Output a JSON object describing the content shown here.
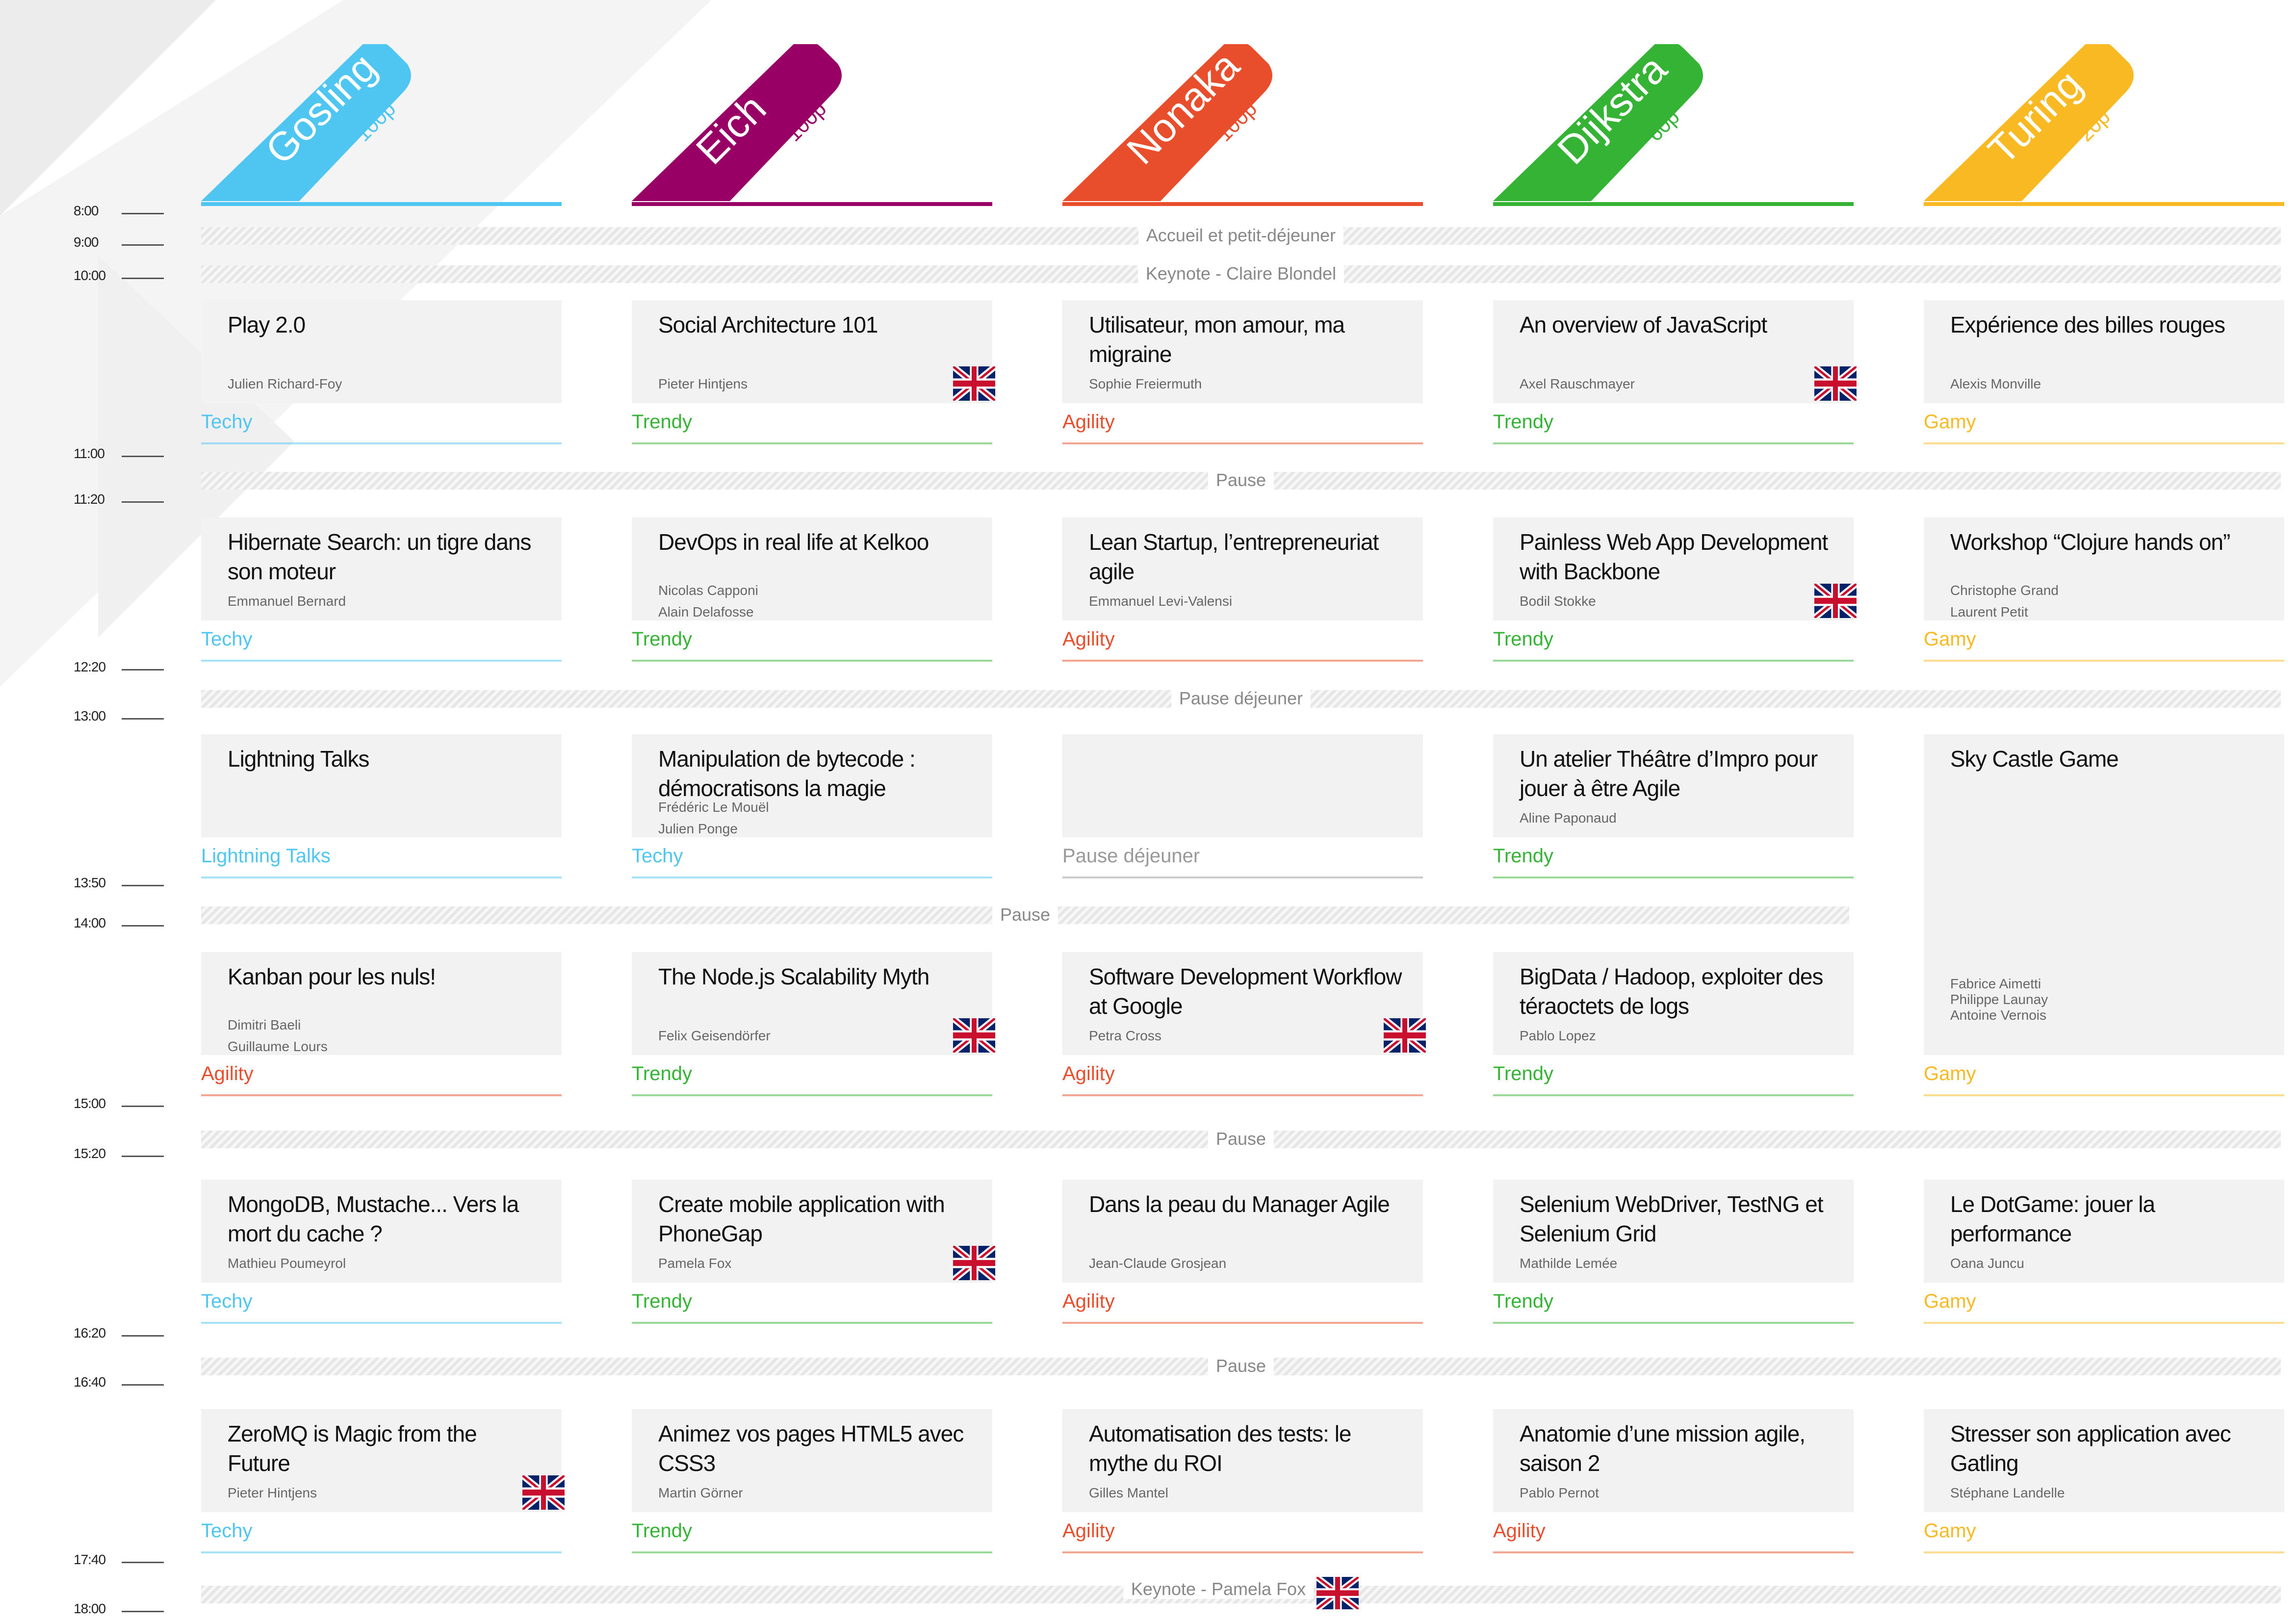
{
  "rooms": [
    {
      "name": "Gosling",
      "capacity": "100p",
      "color": "#4fc6f2"
    },
    {
      "name": "Eich",
      "capacity": "100p",
      "color": "#990066"
    },
    {
      "name": "Nonaka",
      "capacity": "100p",
      "color": "#e94e2c"
    },
    {
      "name": "Dijkstra",
      "capacity": "60p",
      "color": "#35b335"
    },
    {
      "name": "Turing",
      "capacity": "20p",
      "color": "#f8b923"
    }
  ],
  "tracks": {
    "Techy": "#4fc6f2",
    "Trendy": "#35b335",
    "Agility": "#e94e2c",
    "Gamy": "#f8b923",
    "Lightning Talks": "#4fc6f2",
    "Pause déjeuner": "#999999"
  },
  "times": [
    "8:00",
    "9:00",
    "10:00",
    "11:00",
    "11:20",
    "12:20",
    "13:00",
    "13:50",
    "14:00",
    "15:00",
    "15:20",
    "16:20",
    "16:40",
    "17:40",
    "18:00"
  ],
  "breaks": [
    "Accueil et petit-déjeuner",
    "Keynote - Claire Blondel",
    "Pause",
    "Pause déjeuner",
    "Pause",
    "Pause",
    "Pause",
    "Keynote - Pamela Fox"
  ],
  "sessions": [
    [
      {
        "title": "Play 2.0",
        "speakers": [
          "Julien Richard-Foy"
        ],
        "track": "Techy",
        "flag": false
      },
      {
        "title": "Social Architecture 101",
        "speakers": [
          "Pieter Hintjens"
        ],
        "track": "Trendy",
        "flag": true
      },
      {
        "title": "Utilisateur, mon amour, ma migraine",
        "speakers": [
          "Sophie Freiermuth"
        ],
        "track": "Agility",
        "flag": false
      },
      {
        "title": "An overview of JavaScript",
        "speakers": [
          "Axel Rauschmayer"
        ],
        "track": "Trendy",
        "flag": true
      },
      {
        "title": "Expérience des billes rouges",
        "speakers": [
          "Alexis Monville"
        ],
        "track": "Gamy",
        "flag": false
      }
    ],
    [
      {
        "title": "Hibernate Search: un tigre dans son moteur",
        "speakers": [
          "Emmanuel Bernard"
        ],
        "track": "Techy",
        "flag": false
      },
      {
        "title": "DevOps in real life at Kelkoo",
        "speakers": [
          "Nicolas Capponi",
          "Alain Delafosse"
        ],
        "track": "Trendy",
        "flag": false
      },
      {
        "title": "Lean Startup, l’entrepreneuriat agile",
        "speakers": [
          "Emmanuel Levi-Valensi"
        ],
        "track": "Agility",
        "flag": false
      },
      {
        "title": "Painless Web App Development with Backbone",
        "speakers": [
          "Bodil Stokke"
        ],
        "track": "Trendy",
        "flag": true
      },
      {
        "title": "Workshop “Clojure hands on”",
        "speakers": [
          "Christophe Grand",
          "Laurent Petit"
        ],
        "track": "Gamy",
        "flag": false
      }
    ],
    [
      {
        "title": "Lightning Talks",
        "speakers": [],
        "track": "Lightning Talks",
        "flag": false
      },
      {
        "title": "Manipulation de bytecode : démocratisons la magie",
        "speakers": [
          "Frédéric Le Mouël",
          "Julien Ponge"
        ],
        "track": "Techy",
        "flag": false
      },
      {
        "title": "",
        "speakers": [],
        "track": "Pause déjeuner",
        "flag": false
      },
      {
        "title": "Un atelier Théâtre d’Impro pour jouer à être Agile",
        "speakers": [
          "Aline Paponaud"
        ],
        "track": "Trendy",
        "flag": false
      },
      {
        "title": "Sky Castle Game",
        "speakers": [
          "Fabrice Aimetti",
          "Philippe Launay",
          "Antoine Vernois"
        ],
        "track": "Gamy",
        "flag": false
      }
    ],
    [
      {
        "title": "Kanban pour les nuls!",
        "speakers": [
          "Dimitri Baeli",
          "Guillaume Lours"
        ],
        "track": "Agility",
        "flag": false
      },
      {
        "title": "The Node.js Scalability Myth",
        "speakers": [
          "Felix Geisendörfer"
        ],
        "track": "Trendy",
        "flag": true
      },
      {
        "title": "Software Development Workflow at Google",
        "speakers": [
          "Petra Cross"
        ],
        "track": "Agility",
        "flag": true
      },
      {
        "title": "BigData / Hadoop, exploiter des téraoctets de logs",
        "speakers": [
          "Pablo Lopez"
        ],
        "track": "Trendy",
        "flag": false
      }
    ],
    [
      {
        "title": "MongoDB, Mustache... Vers la mort du cache ?",
        "speakers": [
          "Mathieu Poumeyrol"
        ],
        "track": "Techy",
        "flag": false
      },
      {
        "title": "Create mobile application with PhoneGap",
        "speakers": [
          "Pamela Fox"
        ],
        "track": "Trendy",
        "flag": true
      },
      {
        "title": "Dans la peau du Manager Agile",
        "speakers": [
          "Jean-Claude Grosjean"
        ],
        "track": "Agility",
        "flag": false
      },
      {
        "title": "Selenium WebDriver, TestNG et Selenium Grid",
        "speakers": [
          "Mathilde Lemée"
        ],
        "track": "Trendy",
        "flag": false
      },
      {
        "title": "Le DotGame: jouer la performance",
        "speakers": [
          "Oana Juncu"
        ],
        "track": "Gamy",
        "flag": false
      }
    ],
    [
      {
        "title": "ZeroMQ is Magic from the Future",
        "speakers": [
          "Pieter Hintjens"
        ],
        "track": "Techy",
        "flag": true
      },
      {
        "title": "Animez vos pages HTML5 avec CSS3",
        "speakers": [
          "Martin Görner"
        ],
        "track": "Trendy",
        "flag": false
      },
      {
        "title": "Automatisation des tests: le mythe du ROI",
        "speakers": [
          "Gilles Mantel"
        ],
        "track": "Agility",
        "flag": false
      },
      {
        "title": "Anatomie d’une mission agile, saison 2",
        "speakers": [
          "Pablo Pernot"
        ],
        "track": "Agility",
        "flag": false
      },
      {
        "title": "Stresser son application avec Gatling",
        "speakers": [
          "Stéphane Landelle"
        ],
        "track": "Gamy",
        "flag": false
      }
    ]
  ]
}
